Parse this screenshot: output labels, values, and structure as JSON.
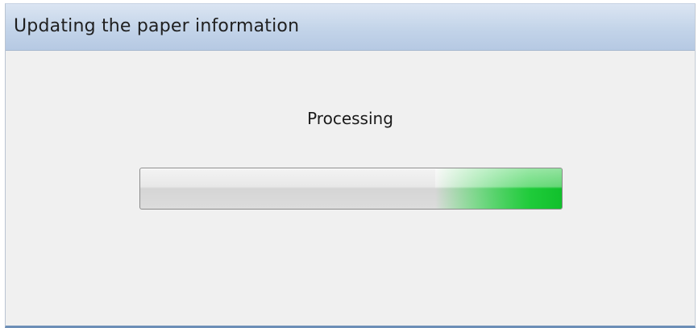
{
  "window": {
    "title": "Updating the paper information"
  },
  "dialog": {
    "status_text": "Processing",
    "progress": {
      "style": "marquee",
      "fill_fraction": 0.3,
      "color": "#11c02c"
    }
  }
}
